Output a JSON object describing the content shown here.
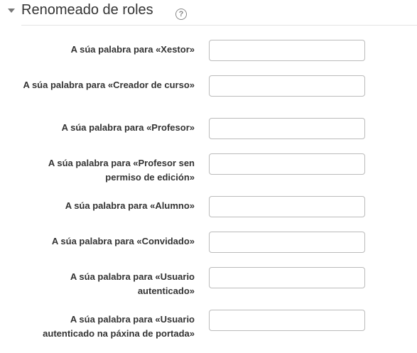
{
  "section": {
    "title": "Renomeado de roles",
    "help_glyph": "?",
    "collapse_icon": "chevron-down-icon",
    "help_icon": "question-circle-icon"
  },
  "fields": [
    {
      "label": "A súa palabra para «Xestor»",
      "value": "",
      "placeholder": ""
    },
    {
      "label": "A súa palabra para «Creador de curso»",
      "value": "",
      "placeholder": ""
    },
    {
      "label": "A súa palabra para «Profesor»",
      "value": "",
      "placeholder": ""
    },
    {
      "label": "A súa palabra para «Profesor sen permiso de edición»",
      "value": "",
      "placeholder": ""
    },
    {
      "label": "A súa palabra para «Alumno»",
      "value": "",
      "placeholder": ""
    },
    {
      "label": "A súa palabra para «Convidado»",
      "value": "",
      "placeholder": ""
    },
    {
      "label": "A súa palabra para «Usuario autenticado»",
      "value": "",
      "placeholder": ""
    },
    {
      "label": "A súa palabra para «Usuario autenticado na páxina de portada»",
      "value": "",
      "placeholder": ""
    }
  ]
}
